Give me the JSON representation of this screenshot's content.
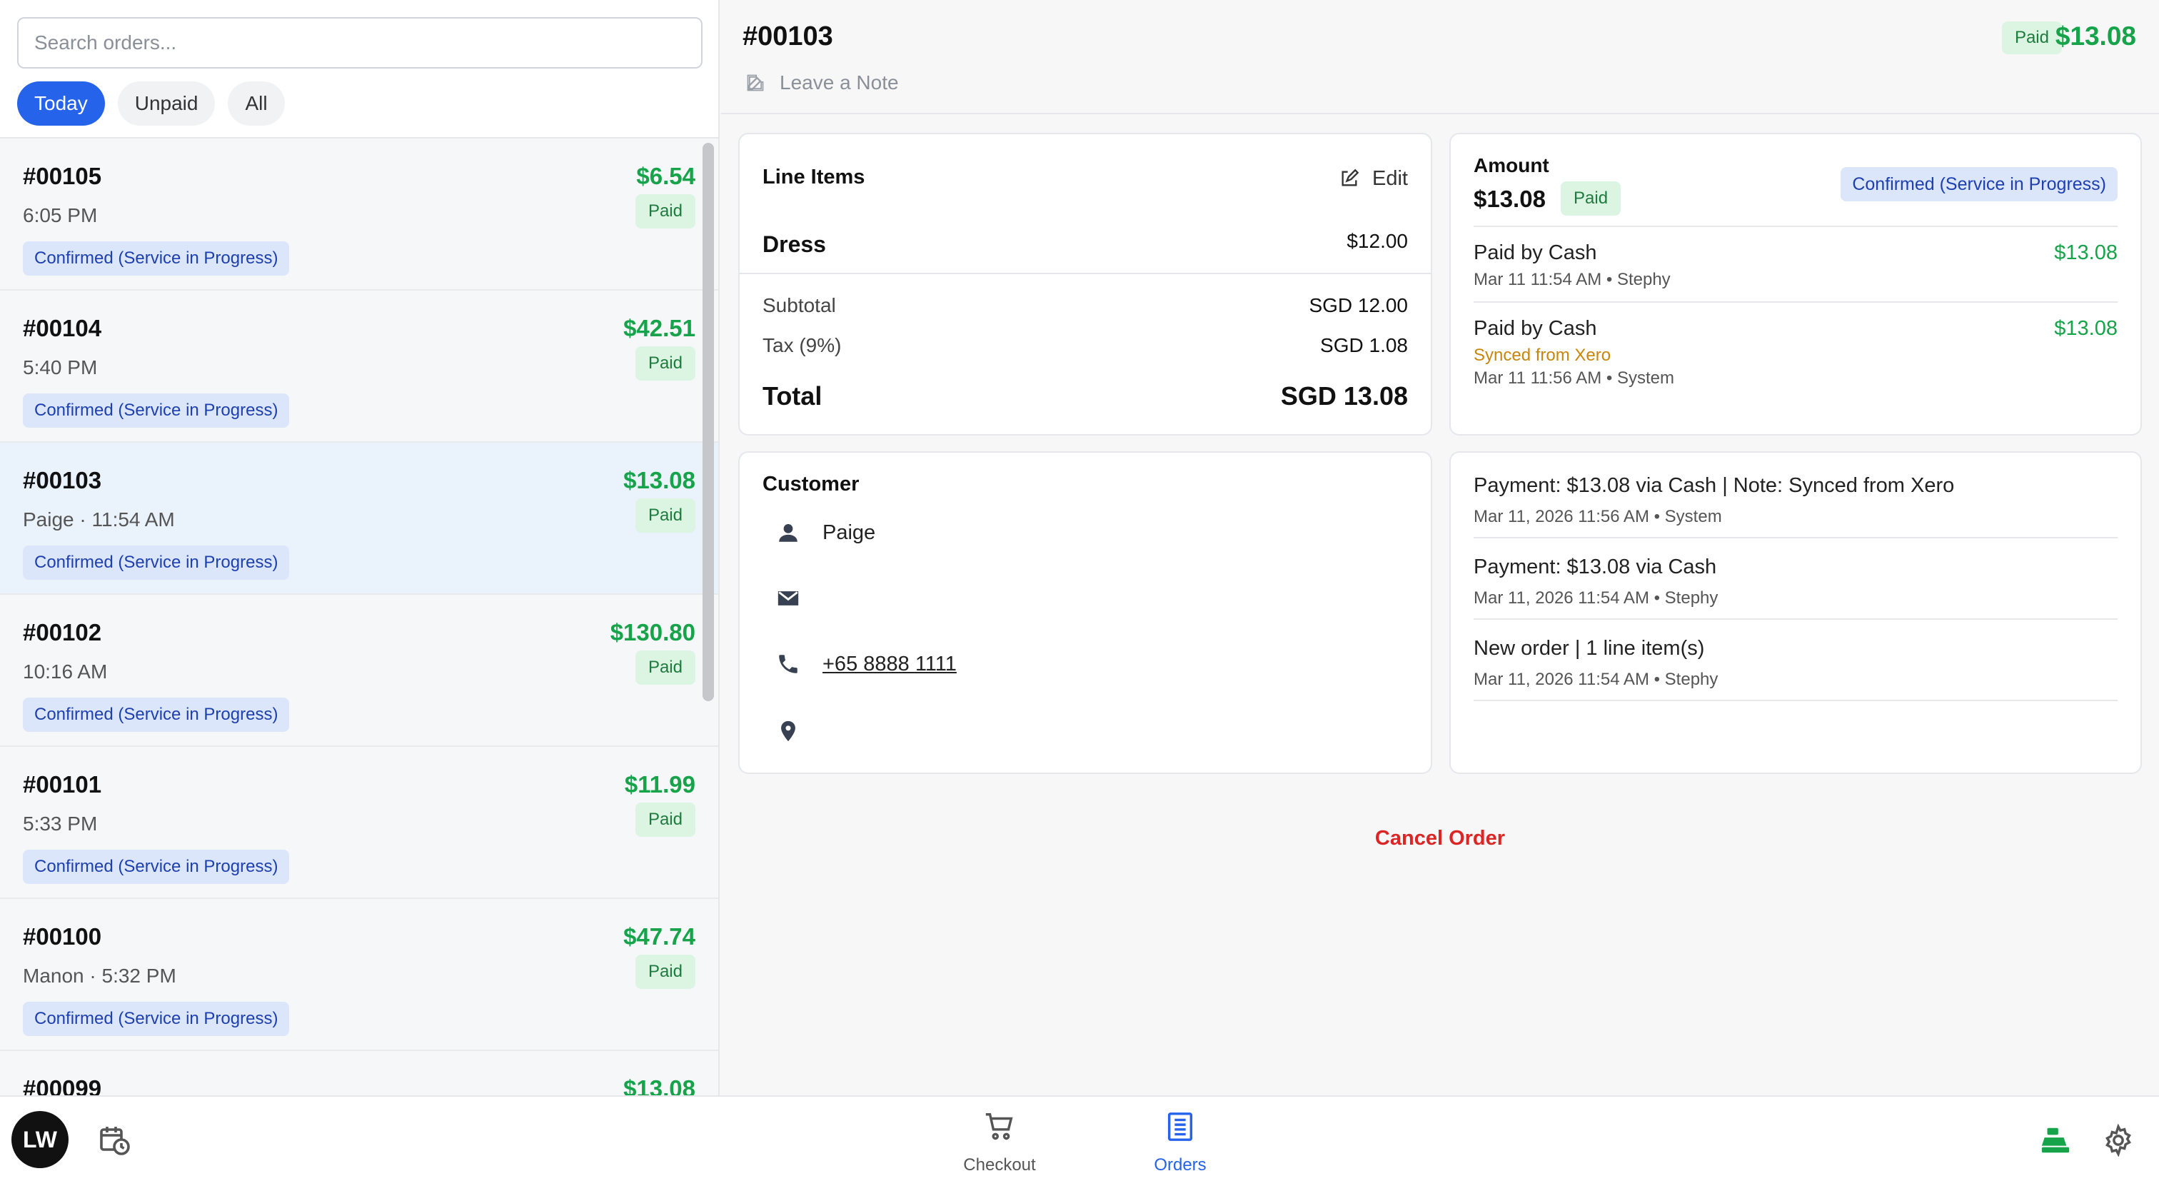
{
  "search": {
    "placeholder": "Search orders..."
  },
  "filters": [
    "Today",
    "Unpaid",
    "All"
  ],
  "orders": [
    {
      "number": "#00105",
      "sub": "6:05 PM",
      "amount": "$6.54",
      "payment": "Paid",
      "status": "Confirmed (Service in Progress)"
    },
    {
      "number": "#00104",
      "sub": "5:40 PM",
      "amount": "$42.51",
      "payment": "Paid",
      "status": "Confirmed (Service in Progress)"
    },
    {
      "number": "#00103",
      "sub": "Paige · 11:54 AM",
      "amount": "$13.08",
      "payment": "Paid",
      "status": "Confirmed (Service in Progress)"
    },
    {
      "number": "#00102",
      "sub": "10:16 AM",
      "amount": "$130.80",
      "payment": "Paid",
      "status": "Confirmed (Service in Progress)"
    },
    {
      "number": "#00101",
      "sub": "5:33 PM",
      "amount": "$11.99",
      "payment": "Paid",
      "status": "Confirmed (Service in Progress)"
    },
    {
      "number": "#00100",
      "sub": "Manon · 5:32 PM",
      "amount": "$47.74",
      "payment": "Paid",
      "status": "Confirmed (Service in Progress)"
    },
    {
      "number": "#00099",
      "sub": "",
      "amount": "$13.08",
      "payment": "",
      "status": ""
    }
  ],
  "detail": {
    "title": "#00103",
    "note_label": "Leave a Note",
    "payment_badge": "Paid",
    "amount": "$13.08",
    "line_items": {
      "title": "Line Items",
      "edit_label": "Edit",
      "items": [
        {
          "name": "Dress",
          "price": "$12.00"
        }
      ],
      "subtotal_label": "Subtotal",
      "subtotal": "SGD 12.00",
      "tax_label": "Tax (9%)",
      "tax": "SGD 1.08",
      "total_label": "Total",
      "total": "SGD 13.08"
    },
    "amount_card": {
      "label": "Amount",
      "value": "$13.08",
      "badge": "Paid",
      "status": "Confirmed (Service in Progress)",
      "payments": [
        {
          "method": "Paid by Cash",
          "amount": "$13.08",
          "sync": "",
          "meta": "Mar 11 11:54 AM • Stephy"
        },
        {
          "method": "Paid by Cash",
          "amount": "$13.08",
          "sync": "Synced from Xero",
          "meta": "Mar 11 11:56 AM • System"
        }
      ]
    },
    "customer": {
      "title": "Customer",
      "name": "Paige",
      "email": "",
      "phone": "+65 8888 1111",
      "address": ""
    },
    "history": [
      {
        "text": "Payment: $13.08 via Cash | Note: Synced from Xero",
        "meta": "Mar 11, 2026 11:56 AM • System"
      },
      {
        "text": "Payment: $13.08 via Cash",
        "meta": "Mar 11, 2026 11:54 AM • Stephy"
      },
      {
        "text": "New order | 1 line item(s)",
        "meta": "Mar 11, 2026 11:54 AM • Stephy"
      }
    ],
    "cancel_label": "Cancel Order"
  },
  "bottom": {
    "avatar": "LW",
    "nav": [
      {
        "label": "Checkout",
        "icon": "cart-icon"
      },
      {
        "label": "Orders",
        "icon": "orders-list-icon"
      }
    ],
    "active": "Orders"
  },
  "colors": {
    "accent": "#2563eb",
    "paid_green": "#16a34a",
    "cancel_red": "#dc2626",
    "sync_orange": "#c8860d"
  }
}
